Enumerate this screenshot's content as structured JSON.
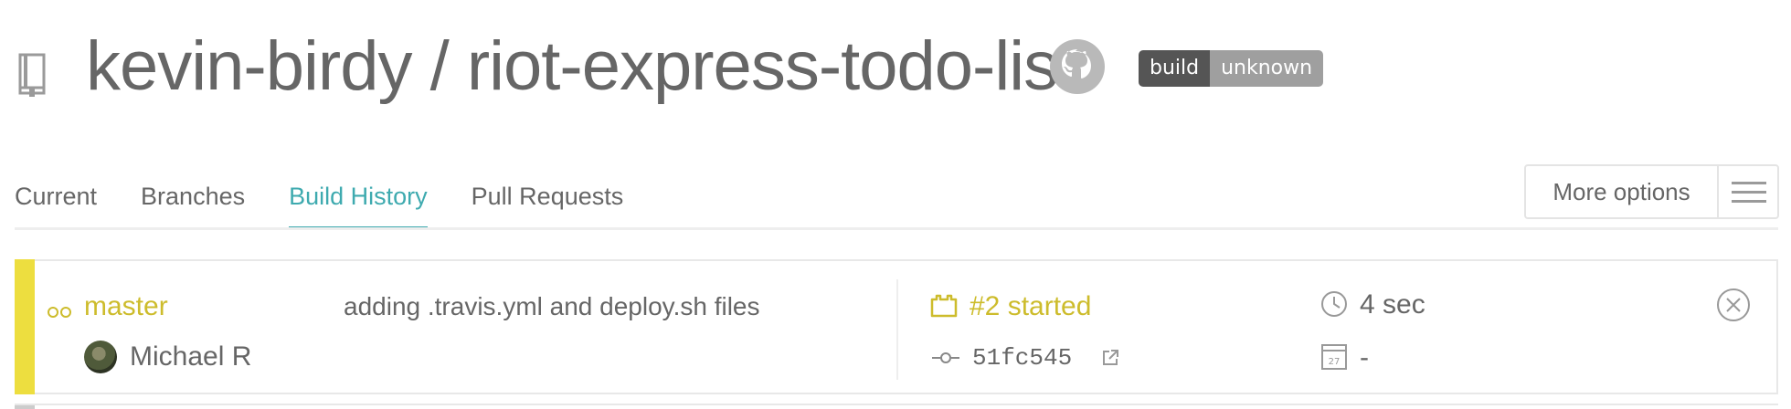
{
  "header": {
    "repo_owner": "kevin-birdy",
    "repo_separator": " / ",
    "repo_name": "riot-express-todo-list",
    "badge": {
      "left": "build",
      "right": "unknown"
    },
    "icons": {
      "repo": "repo-icon",
      "github": "github-icon"
    }
  },
  "tabs": [
    {
      "label": "Current",
      "active": false
    },
    {
      "label": "Branches",
      "active": false
    },
    {
      "label": "Build History",
      "active": true
    },
    {
      "label": "Pull Requests",
      "active": false
    }
  ],
  "more_options": {
    "label": "More options",
    "icon": "hamburger-icon"
  },
  "build": {
    "state": "started",
    "status_color": "#edde3f",
    "branch": "master",
    "author": "Michael R",
    "message": "adding .travis.yml and deploy.sh files",
    "number_label": "#2 started",
    "commit": "51fc545",
    "duration": "4 sec",
    "finished": "-"
  },
  "colors": {
    "accent": "#3eaaaf",
    "started": "#cdbc2c",
    "text": "#666666"
  }
}
